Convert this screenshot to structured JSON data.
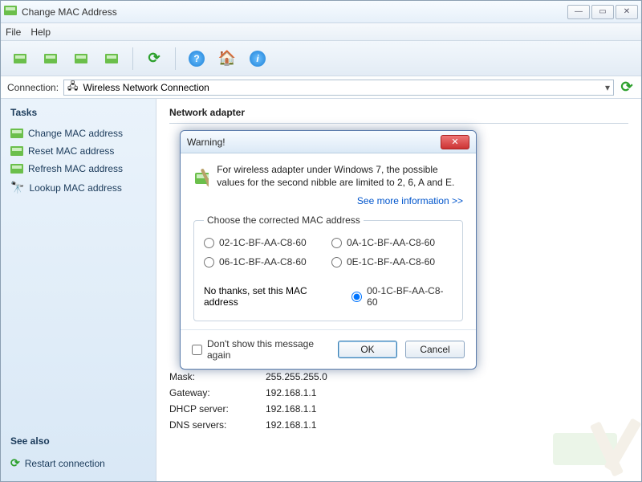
{
  "window": {
    "title": "Change MAC Address"
  },
  "menu": {
    "file": "File",
    "help": "Help"
  },
  "connection": {
    "label": "Connection:",
    "value": "Wireless Network Connection"
  },
  "sidebar": {
    "tasks_heading": "Tasks",
    "tasks": [
      {
        "label": "Change MAC address"
      },
      {
        "label": "Reset MAC address"
      },
      {
        "label": "Refresh MAC address"
      },
      {
        "label": "Lookup MAC address"
      }
    ],
    "see_also_heading": "See also",
    "see_also": [
      {
        "label": "Restart connection"
      }
    ]
  },
  "content": {
    "heading": "Network adapter",
    "rows": [
      {
        "k": "Mask:",
        "v": "255.255.255.0"
      },
      {
        "k": "Gateway:",
        "v": "192.168.1.1"
      },
      {
        "k": "DHCP server:",
        "v": "192.168.1.1"
      },
      {
        "k": "DNS servers:",
        "v": "192.168.1.1"
      }
    ]
  },
  "dialog": {
    "title": "Warning!",
    "message": "For wireless adapter under Windows 7, the possible values for the second nibble are limited to 2, 6, A and E.",
    "link": "See more information >>",
    "fieldset_legend": "Choose the corrected MAC address",
    "options": [
      "02-1C-BF-AA-C8-60",
      "0A-1C-BF-AA-C8-60",
      "06-1C-BF-AA-C8-60",
      "0E-1C-BF-AA-C8-60"
    ],
    "no_thanks_label": "No thanks, set this MAC address",
    "no_thanks_value": "00-1C-BF-AA-C8-60",
    "dont_show": "Don't show this message again",
    "ok": "OK",
    "cancel": "Cancel"
  }
}
